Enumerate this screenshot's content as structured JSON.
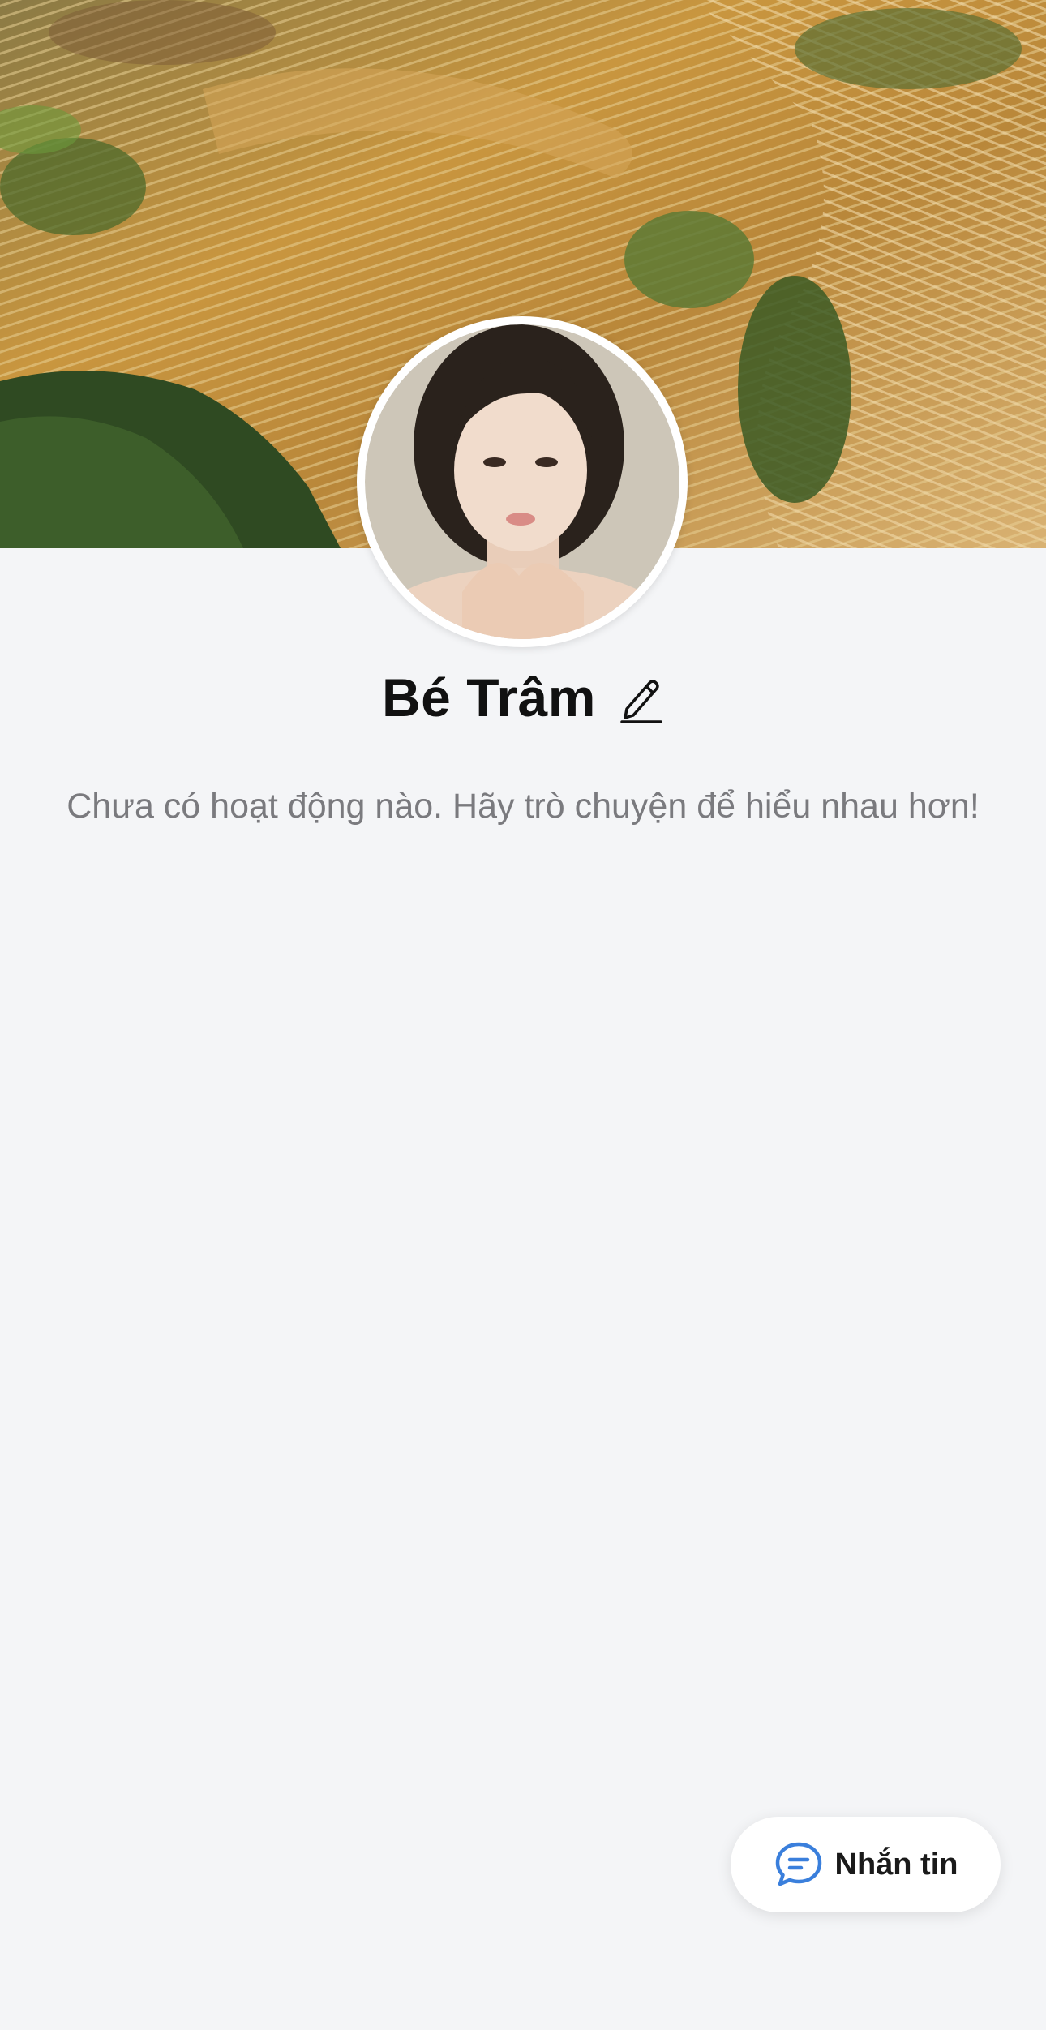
{
  "profile": {
    "name": "Bé Trâm",
    "empty_message": "Chưa có hoạt động nào. Hãy trò chuyện để hiểu nhau hơn!"
  },
  "actions": {
    "message_label": "Nhắn tin"
  },
  "icons": {
    "edit": "pencil-icon",
    "message": "chat-bubble-icon"
  },
  "colors": {
    "background": "#f4f5f7",
    "accent": "#3a7fdc",
    "text_primary": "#111111",
    "text_secondary": "#7a7a7e"
  }
}
